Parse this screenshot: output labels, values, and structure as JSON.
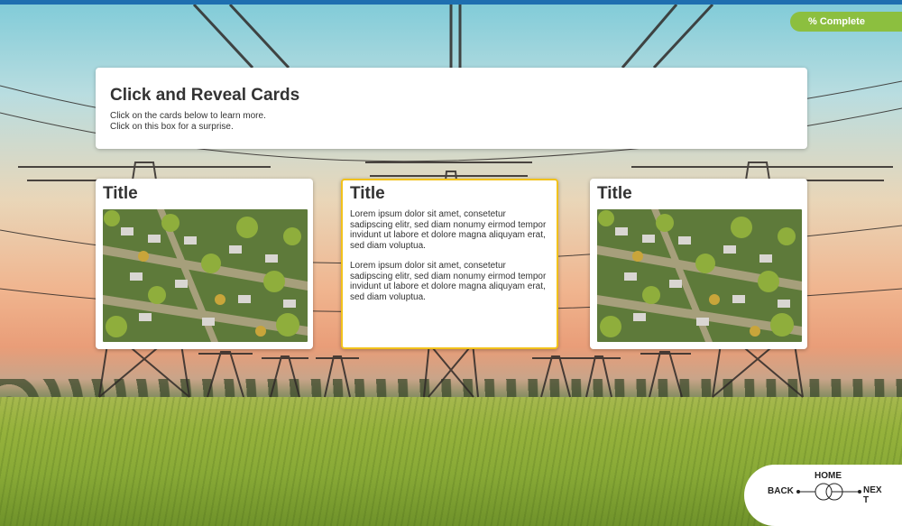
{
  "progress": {
    "label": "% Complete"
  },
  "header": {
    "title": "Click and Reveal Cards",
    "line1": "Click on the cards below to learn more.",
    "line2": "Click on this box for a surprise."
  },
  "cards": [
    {
      "title": "Title",
      "image": "suburb-aerial-photo"
    },
    {
      "title": "Title",
      "paragraph1": "Lorem ipsum dolor sit amet, consetetur sadipscing elitr, sed diam nonumy eirmod tempor invidunt ut labore et dolore magna aliquyam erat, sed diam voluptua.",
      "paragraph2": "Lorem ipsum dolor sit amet, consetetur sadipscing elitr, sed diam nonumy eirmod tempor invidunt ut labore et dolore magna aliquyam erat, sed diam voluptua."
    },
    {
      "title": "Title",
      "image": "suburb-aerial-photo"
    }
  ],
  "nav": {
    "home": "HOME",
    "back": "BACK",
    "next": "NEX\nT"
  },
  "colors": {
    "accent_bar": "#1e6fb0",
    "progress_pill": "#8cbf3f",
    "selected_border": "#f2c21b"
  }
}
